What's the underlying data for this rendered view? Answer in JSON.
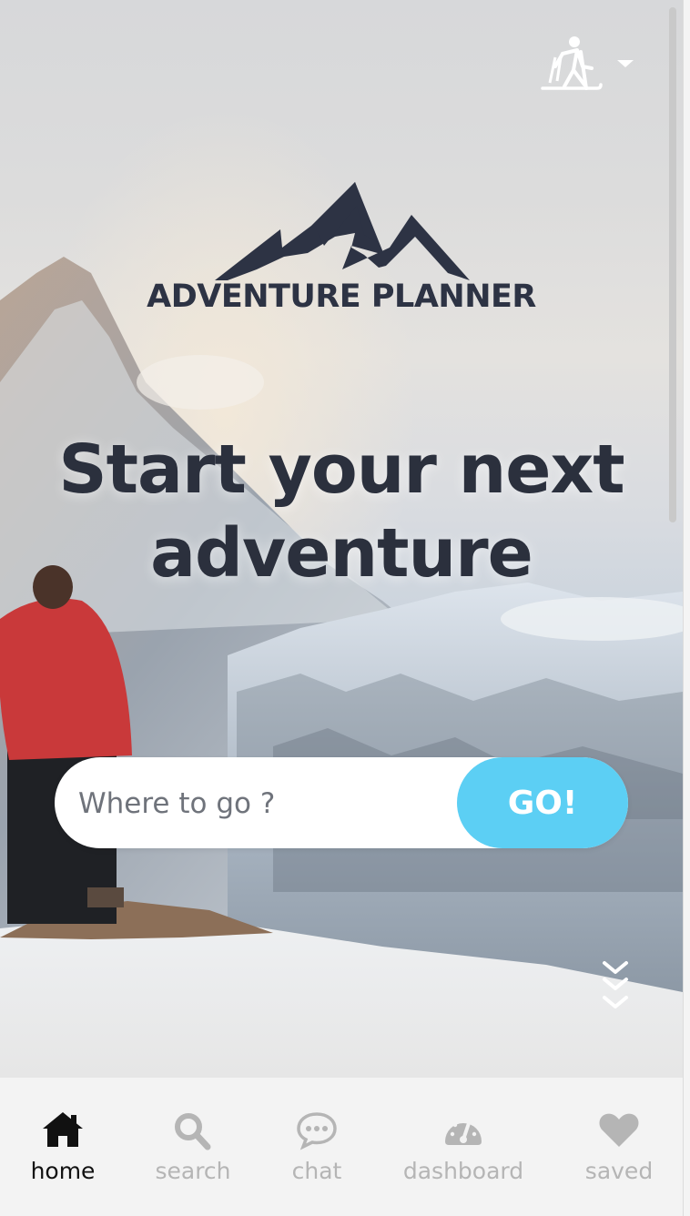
{
  "brand": {
    "name": "ADVENTURE PLANNER"
  },
  "user_menu": {
    "icon": "hiker-icon",
    "dropdown_icon": "caret-down-icon"
  },
  "hero": {
    "headline_line1": "Start your next",
    "headline_line2": "adventure"
  },
  "search": {
    "placeholder": "Where to go ?",
    "value": "",
    "button_label": "GO!"
  },
  "scroll_hint": {
    "icon": "chevrons-down-icon"
  },
  "nav": {
    "items": [
      {
        "label": "home",
        "icon": "home-icon",
        "active": true
      },
      {
        "label": "search",
        "icon": "search-icon",
        "active": false
      },
      {
        "label": "chat",
        "icon": "chat-icon",
        "active": false
      },
      {
        "label": "dashboard",
        "icon": "dashboard-icon",
        "active": false
      },
      {
        "label": "saved",
        "icon": "heart-icon",
        "active": false
      }
    ]
  },
  "colors": {
    "accent": "#5ccff4",
    "text_dark": "#2b303d",
    "nav_active": "#111111",
    "nav_inactive": "#b5b5b5"
  }
}
